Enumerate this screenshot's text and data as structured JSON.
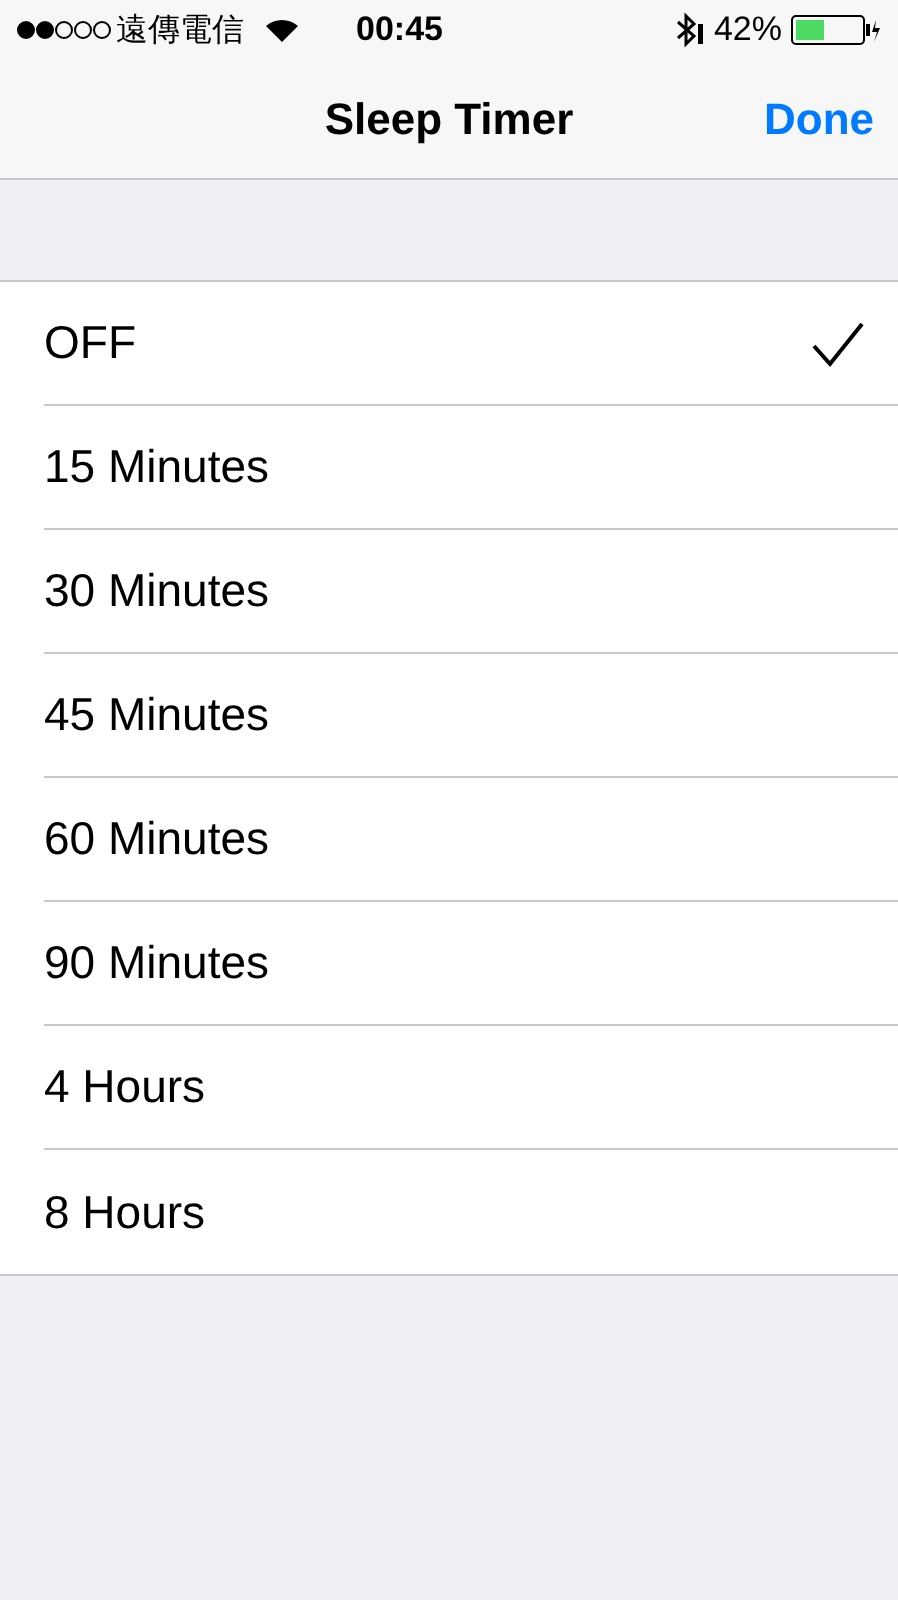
{
  "status_bar": {
    "carrier": "遠傳電信",
    "time": "00:45",
    "battery": "42%"
  },
  "nav": {
    "title": "Sleep Timer",
    "done": "Done"
  },
  "options": [
    {
      "label": "OFF",
      "selected": true
    },
    {
      "label": "15 Minutes",
      "selected": false
    },
    {
      "label": "30 Minutes",
      "selected": false
    },
    {
      "label": "45 Minutes",
      "selected": false
    },
    {
      "label": "60 Minutes",
      "selected": false
    },
    {
      "label": "90 Minutes",
      "selected": false
    },
    {
      "label": "4 Hours",
      "selected": false
    },
    {
      "label": "8 Hours",
      "selected": false
    }
  ]
}
